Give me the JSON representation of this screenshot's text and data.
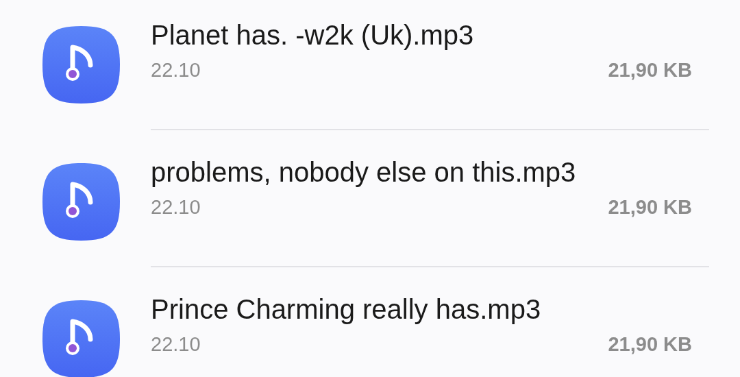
{
  "files": [
    {
      "name": "Planet has. -w2k (Uk).mp3",
      "date": "22.10",
      "size": "21,90 KB"
    },
    {
      "name": "problems, nobody else on this.mp3",
      "date": "22.10",
      "size": "21,90 KB"
    },
    {
      "name": "Prince Charming really has.mp3",
      "date": "22.10",
      "size": "21,90 KB"
    }
  ]
}
